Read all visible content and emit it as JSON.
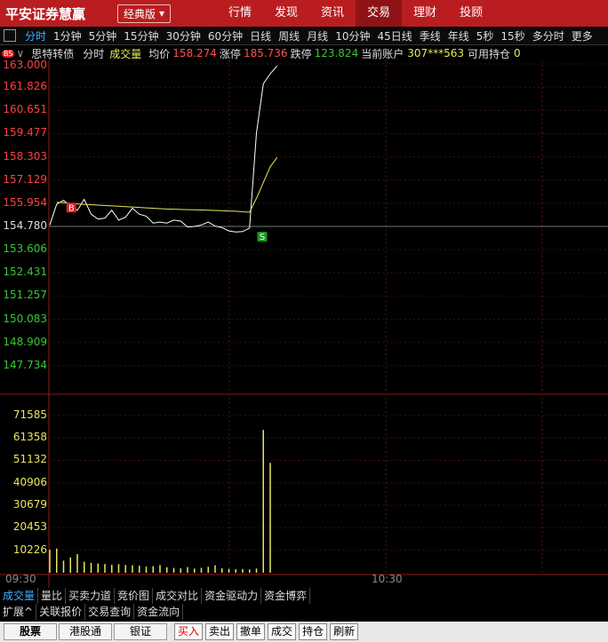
{
  "app": {
    "title": "平安证券慧赢",
    "edition": "经典版"
  },
  "nav": [
    "行情",
    "发现",
    "资讯",
    "交易",
    "理财",
    "投顾"
  ],
  "nav_active": "交易",
  "periods": [
    "分时",
    "1分钟",
    "5分钟",
    "15分钟",
    "30分钟",
    "60分钟",
    "日线",
    "周线",
    "月线",
    "10分钟",
    "45日线",
    "季线",
    "年线",
    "5秒",
    "15秒",
    "多分时",
    "更多"
  ],
  "period_active": "分时",
  "info": {
    "bs_badge": "BS",
    "name": "思特转债",
    "mode": "分时",
    "volume_label": "成交量",
    "avg_label": "均价",
    "avg_value": "158.274",
    "limit_up_label": "涨停",
    "limit_up_value": "185.736",
    "limit_down_label": "跌停",
    "limit_down_value": "123.824",
    "account_label": "当前账户",
    "account_value": "307***563",
    "holding_label": "可用持仓",
    "holding_value": "0"
  },
  "price_axis": [
    "163.000",
    "161.826",
    "160.651",
    "159.477",
    "158.303",
    "157.129",
    "155.954",
    "154.780",
    "153.606",
    "152.431",
    "151.257",
    "150.083",
    "148.909",
    "147.734"
  ],
  "volume_axis": [
    "71585",
    "61358",
    "51132",
    "40906",
    "30679",
    "20453",
    "10226"
  ],
  "time_axis": [
    "09:30",
    "10:30"
  ],
  "markers": {
    "buy": "B",
    "sell": "S"
  },
  "chart_data": {
    "type": "line",
    "title": "",
    "xlabel": "",
    "ylabel": "",
    "ylim": [
      146.56,
      163.0
    ],
    "x": [
      "09:30",
      "09:31",
      "09:32",
      "09:33",
      "09:34",
      "09:35",
      "09:36",
      "09:37",
      "09:38",
      "09:39",
      "09:40",
      "09:41",
      "09:42",
      "09:43",
      "09:44",
      "09:45",
      "09:46",
      "09:47",
      "09:48",
      "09:49",
      "09:50",
      "09:51",
      "09:52",
      "09:53",
      "09:54",
      "09:55",
      "09:56",
      "09:57",
      "09:58",
      "09:59",
      "10:00",
      "10:01",
      "10:02",
      "10:03"
    ],
    "series": [
      {
        "name": "price",
        "values": [
          154.85,
          155.9,
          156.1,
          155.8,
          155.6,
          156.15,
          155.4,
          155.15,
          155.2,
          155.6,
          155.1,
          155.25,
          155.7,
          155.4,
          155.3,
          154.95,
          155.0,
          154.95,
          155.1,
          155.05,
          154.75,
          154.78,
          154.85,
          155.0,
          154.8,
          154.72,
          154.55,
          154.5,
          154.52,
          154.7,
          159.5,
          162.0,
          162.5,
          162.9
        ]
      },
      {
        "name": "avg_price",
        "values": [
          null,
          156.0,
          155.98,
          155.95,
          155.92,
          155.9,
          155.88,
          155.86,
          155.84,
          155.82,
          155.8,
          155.78,
          155.76,
          155.74,
          155.72,
          155.7,
          155.68,
          155.66,
          155.65,
          155.64,
          155.63,
          155.62,
          155.61,
          155.6,
          155.59,
          155.58,
          155.56,
          155.55,
          155.52,
          155.5,
          156.2,
          157.0,
          157.8,
          158.27
        ]
      },
      {
        "name": "volume",
        "values": [
          10500,
          11000,
          5500,
          7000,
          8500,
          5000,
          4500,
          4200,
          4000,
          3600,
          3900,
          3500,
          3400,
          3200,
          2800,
          3000,
          3500,
          2500,
          2200,
          2000,
          2600,
          1900,
          2200,
          2700,
          3400,
          2000,
          1800,
          1600,
          1700,
          1500,
          1900,
          65000,
          50000,
          0
        ]
      }
    ]
  },
  "bottom_tabs": [
    "成交量",
    "量比",
    "买卖力道",
    "竞价图",
    "成交对比",
    "资金驱动力",
    "资金博弈"
  ],
  "bottom_tab_active": "成交量",
  "sub_tabs": [
    "扩展^",
    "关联报价",
    "交易查询",
    "资金流向"
  ],
  "segments": [
    "股票",
    "港股通",
    "银证"
  ],
  "trade_buttons": [
    "买入",
    "卖出",
    "撤单",
    "成交",
    "持仓",
    "刷新"
  ]
}
